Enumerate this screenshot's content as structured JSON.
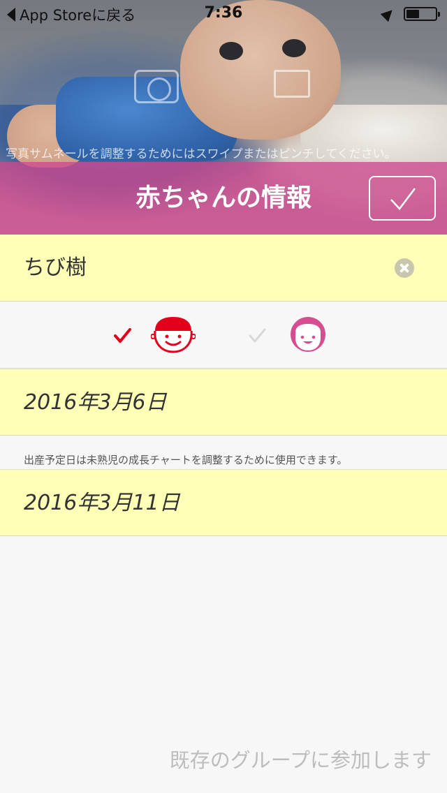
{
  "status_bar": {
    "back_label": "App Storeに戻る",
    "time": "7:36",
    "battery_level": 0.45
  },
  "photo": {
    "hint": "写真サムネールを調整するためにはスワイプまたはピンチしてください。"
  },
  "header": {
    "title": "赤ちゃんの情報"
  },
  "form": {
    "name": "ちび樹",
    "gender": {
      "selected": "boy",
      "selected_color": "#e3001b",
      "unselected_color": "#d8d8d8"
    },
    "birth_date": "2016年3月6日",
    "due_date_note": "出産予定日は未熟児の成長チャートを調整するために使用できます。",
    "due_date": "2016年3月11日"
  },
  "footer": {
    "join_link": "既存のグループに参加します"
  },
  "colors": {
    "accent": "#cd498e",
    "field_background": "#ffffb8",
    "boy": "#e3001b",
    "girl": "#d64d91"
  }
}
